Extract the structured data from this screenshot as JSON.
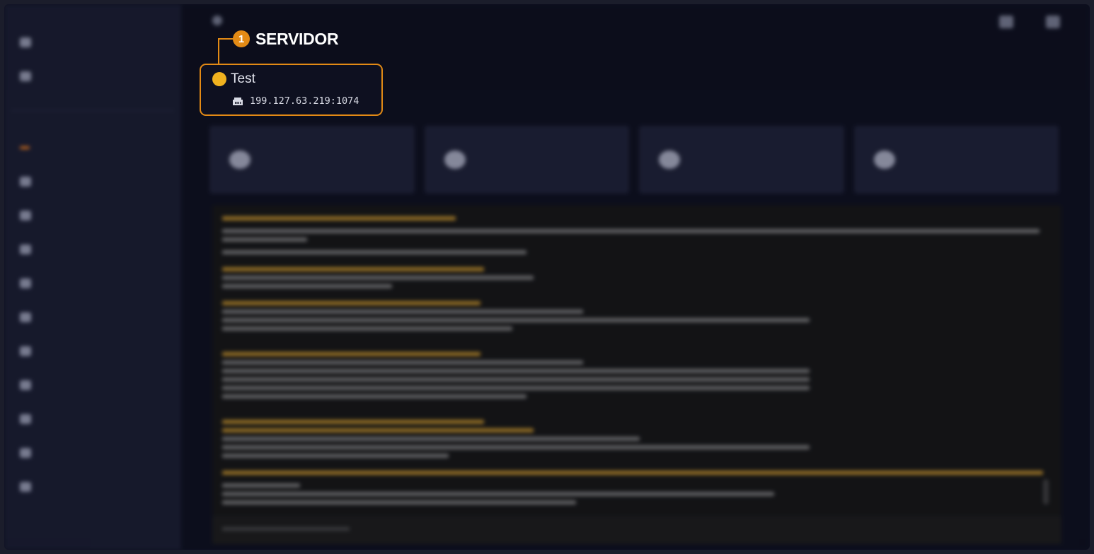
{
  "callout": {
    "number": "1",
    "title": "SERVIDOR"
  },
  "server": {
    "name": "Test",
    "address": "199.127.63.219:1074",
    "status_color": "#f0b21f"
  },
  "colors": {
    "accent": "#e38a15",
    "background": "#0e1020",
    "sidebar": "#181b2e"
  },
  "icons": {
    "network": "ethernet-port-icon"
  }
}
